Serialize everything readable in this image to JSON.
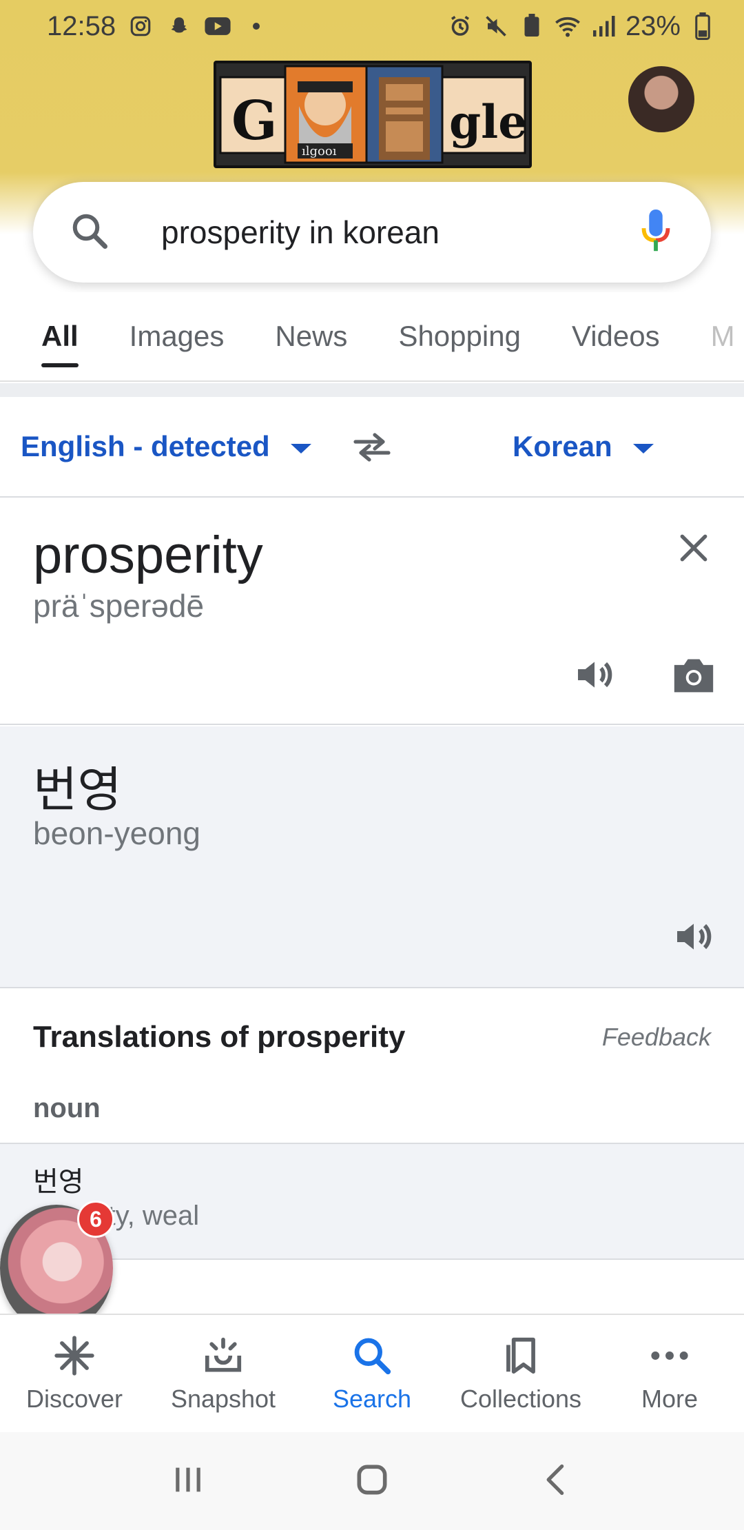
{
  "status_bar": {
    "time": "12:58",
    "battery": "23%"
  },
  "search": {
    "query": "prosperity in korean"
  },
  "tabs": [
    {
      "label": "All",
      "active": true
    },
    {
      "label": "Images"
    },
    {
      "label": "News"
    },
    {
      "label": "Shopping"
    },
    {
      "label": "Videos"
    },
    {
      "label": "M"
    }
  ],
  "translate": {
    "source_lang": "English - detected",
    "target_lang": "Korean",
    "source_word": "prosperity",
    "source_phonetic": "präˈsperədē",
    "target_word": "번영",
    "target_romanization": "beon-yeong"
  },
  "translations": {
    "title": "Translations of prosperity",
    "feedback": "Feedback",
    "part_of_speech": "noun",
    "entries": [
      {
        "word": "번영",
        "synonyms": "erity, weal"
      }
    ]
  },
  "chat_bubble": {
    "badge": "6"
  },
  "bottom_nav": [
    {
      "label": "Discover",
      "icon": "asterisk-icon"
    },
    {
      "label": "Snapshot",
      "icon": "snapshot-icon"
    },
    {
      "label": "Search",
      "icon": "search-icon",
      "active": true
    },
    {
      "label": "Collections",
      "icon": "collections-icon"
    },
    {
      "label": "More",
      "icon": "more-icon"
    }
  ],
  "colors": {
    "header_yellow": "#e5cc62",
    "link_blue": "#1a56c4",
    "active_blue": "#1a73e8",
    "badge_red": "#e53935"
  }
}
